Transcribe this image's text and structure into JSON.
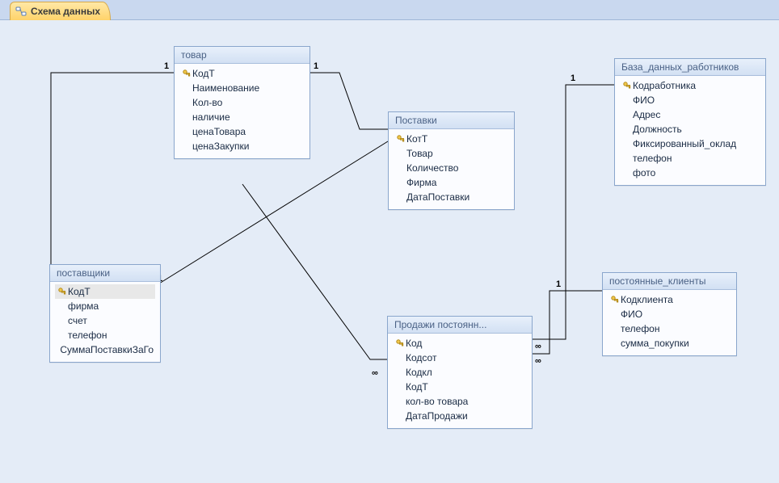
{
  "tab": {
    "label": "Схема данных"
  },
  "tables": {
    "tovar": {
      "title": "товар",
      "fields": [
        {
          "name": "КодТ",
          "pk": true
        },
        {
          "name": "Наименование"
        },
        {
          "name": "Кол-во"
        },
        {
          "name": "наличие"
        },
        {
          "name": "ценаТовара"
        },
        {
          "name": "ценаЗакупки"
        }
      ]
    },
    "postavshiki": {
      "title": "поставщики",
      "fields": [
        {
          "name": "КодТ",
          "pk": true,
          "selected": true
        },
        {
          "name": "фирма"
        },
        {
          "name": "счет"
        },
        {
          "name": "телефон"
        },
        {
          "name": "СуммаПоставкиЗаГо"
        }
      ]
    },
    "postavki": {
      "title": "Поставки",
      "fields": [
        {
          "name": "КотТ",
          "pk": true
        },
        {
          "name": "Товар"
        },
        {
          "name": "Количество"
        },
        {
          "name": "Фирма"
        },
        {
          "name": "ДатаПоставки"
        }
      ]
    },
    "prodazhi": {
      "title": "Продажи постоянн...",
      "fields": [
        {
          "name": "Код",
          "pk": true
        },
        {
          "name": "Кодсот"
        },
        {
          "name": "Кодкл"
        },
        {
          "name": "КодТ"
        },
        {
          "name": "кол-во товара"
        },
        {
          "name": "ДатаПродажи"
        }
      ]
    },
    "rabotniki": {
      "title": "База_данных_работников",
      "fields": [
        {
          "name": "Кодработника",
          "pk": true
        },
        {
          "name": "ФИО"
        },
        {
          "name": "Адрес"
        },
        {
          "name": "Должность"
        },
        {
          "name": "Фиксированный_оклад"
        },
        {
          "name": "телефон"
        },
        {
          "name": "фото"
        }
      ]
    },
    "klienty": {
      "title": "постоянные_клиенты",
      "fields": [
        {
          "name": "Кодклиента",
          "pk": true
        },
        {
          "name": "ФИО"
        },
        {
          "name": "телефон"
        },
        {
          "name": "сумма_покупки"
        }
      ]
    }
  },
  "relations": {
    "r1": {
      "left": "1",
      "right": "1"
    },
    "r2": {
      "left": "1",
      "right": "1"
    },
    "r3": {
      "left": "",
      "right": ""
    },
    "r4": {
      "left": "",
      "right": "∞"
    },
    "r5": {
      "left": "∞",
      "right": "1"
    },
    "r6": {
      "left": "∞",
      "right": "1"
    }
  }
}
